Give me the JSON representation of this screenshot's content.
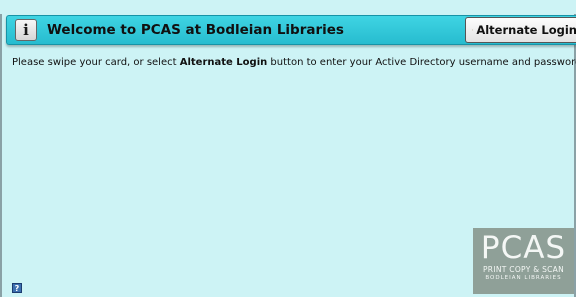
{
  "header": {
    "title": "Welcome to PCAS at Bodleian Libraries",
    "info_glyph": "i",
    "alternate_login_label": "Alternate Login"
  },
  "instruction": {
    "prefix": "Please swipe your card, or select ",
    "emphasis": "Alternate Login",
    "suffix": " button to enter your Active Directory username and password"
  },
  "logo": {
    "main": "PCAS",
    "line1": "PRINT COPY & SCAN",
    "line2": "BODLEIAN LIBRARIES"
  },
  "help_icon": {
    "glyph": "?"
  },
  "colors": {
    "background": "#cdf3f5",
    "header": "#2ac0d2",
    "logo_bg": "#8fa098"
  },
  "icons": [
    "info-icon",
    "key-icon",
    "help-icon"
  ]
}
